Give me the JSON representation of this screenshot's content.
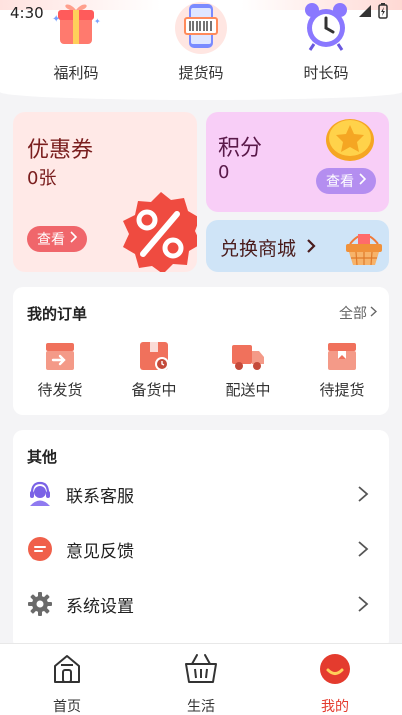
{
  "status_bar": {
    "time": "4:30"
  },
  "quick_codes": [
    {
      "label": "福利码",
      "icon": "gift-icon"
    },
    {
      "label": "提货码",
      "icon": "phone-barcode-icon"
    },
    {
      "label": "时长码",
      "icon": "alarm-clock-icon"
    }
  ],
  "coupon": {
    "title": "优惠券",
    "count": "0张",
    "view_label": "查看"
  },
  "points": {
    "title": "积分",
    "count": "0",
    "view_label": "查看"
  },
  "mall": {
    "title": "兑换商城"
  },
  "orders": {
    "heading": "我的订单",
    "all_label": "全部",
    "items": [
      {
        "label": "待发货",
        "icon": "shipping-box-icon"
      },
      {
        "label": "备货中",
        "icon": "stock-box-icon"
      },
      {
        "label": "配送中",
        "icon": "delivery-truck-icon"
      },
      {
        "label": "待提货",
        "icon": "pickup-box-icon"
      }
    ]
  },
  "other": {
    "heading": "其他",
    "items": [
      {
        "label": "联系客服",
        "icon": "headset-icon"
      },
      {
        "label": "意见反馈",
        "icon": "feedback-icon"
      },
      {
        "label": "系统设置",
        "icon": "gear-icon"
      }
    ]
  },
  "tabbar": {
    "items": [
      {
        "label": "首页",
        "icon": "home-icon"
      },
      {
        "label": "生活",
        "icon": "basket-icon"
      },
      {
        "label": "我的",
        "icon": "profile-icon"
      }
    ],
    "active_color": "#e43b2e"
  }
}
